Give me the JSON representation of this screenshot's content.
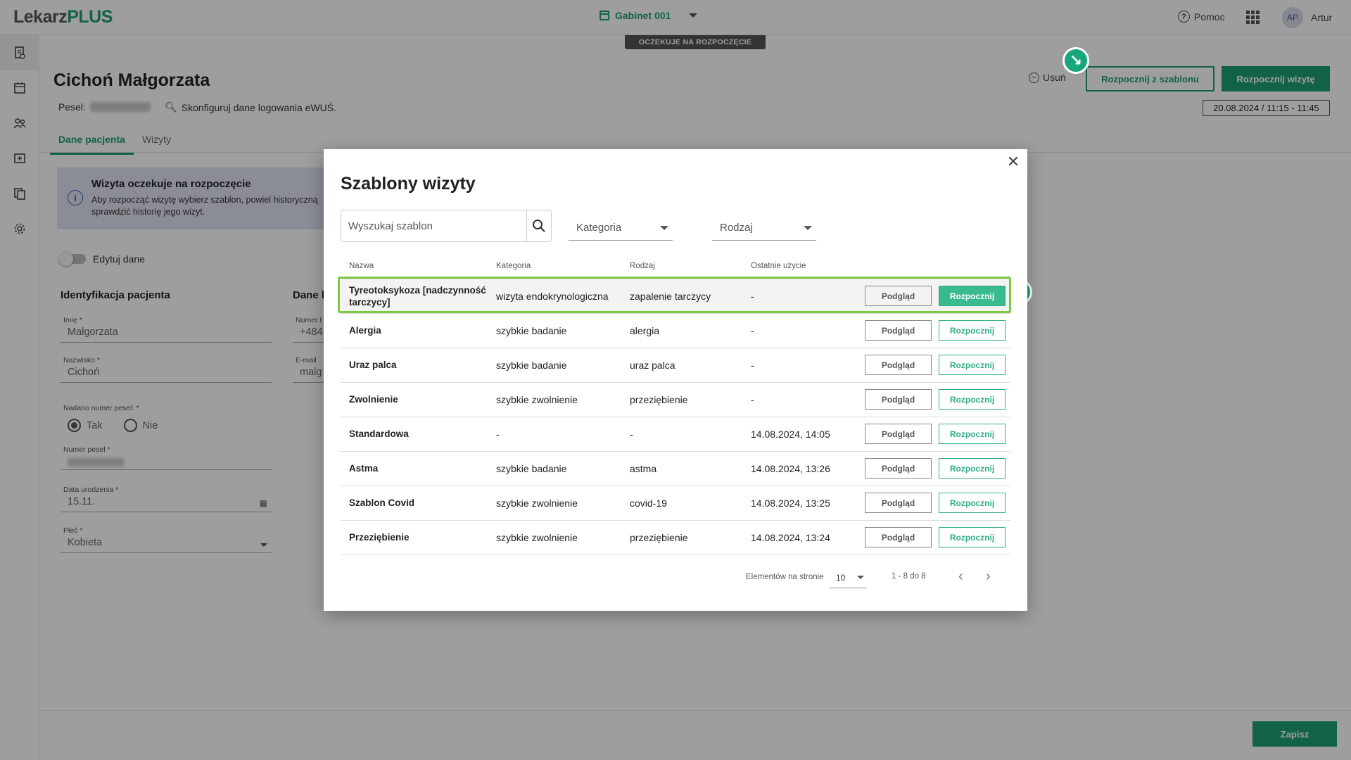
{
  "app": {
    "logo_main": "Lekarz",
    "logo_accent": "PLUS"
  },
  "topbar": {
    "office": "Gabinet 001",
    "help": "Pomoc",
    "avatar_initials": "AP",
    "username": "Artur"
  },
  "sidebar": {
    "items": [
      "document-icon",
      "calendar-icon",
      "patients-icon",
      "add-visit-icon",
      "copy-icon",
      "settings-icon"
    ],
    "expand_icon": "→"
  },
  "visit": {
    "status": "OCZEKUJE NA ROZPOCZĘCIE",
    "patient_name": "Cichoń Małgorzata",
    "pesel_label": "Pesel:",
    "ewus_text": "Skonfiguruj dane logowania eWUŚ.",
    "delete_label": "Usuń",
    "start_from_template_label": "Rozpocznij z szablonu",
    "start_visit_label": "Rozpocznij wizytę",
    "date": "20.08.2024 / 11:15 - 11:45"
  },
  "tabs": [
    "Dane pacjenta",
    "Wizyty"
  ],
  "info": {
    "title": "Wizyta oczekuje na rozpoczęcie",
    "line1": "Aby rozpocząć wizytę wybierz szablon, powiel historyczną",
    "line2": "sprawdzić historię jego wizyt."
  },
  "form": {
    "edit_toggle": "Edytuj dane",
    "section_id": "Identyfikacja pacjenta",
    "section_data": "Dane k",
    "first_name_label": "Imię *",
    "first_name": "Małgorzata",
    "last_name_label": "Nazwisko *",
    "last_name": "Cichoń",
    "pesel_assigned_label": "Nadano numer pesel: *",
    "yes": "Tak",
    "no": "Nie",
    "pesel_number_label": "Numer pesel *",
    "birth_label": "Data urodzenia *",
    "birth": "15.11.",
    "sex_label": "Płeć *",
    "sex": "Kobieta",
    "phone_label": "Numer t",
    "phone": "+484",
    "email_label": "E-mail",
    "email": "malg"
  },
  "footer": {
    "save_label": "Zapisz"
  },
  "modal": {
    "title": "Szablony wizyty",
    "search_placeholder": "Wyszukaj szablon",
    "category_select": "Kategoria",
    "kind_select": "Rodzaj",
    "columns": [
      "Nazwa",
      "Kategoria",
      "Rodzaj",
      "Ostatnie użycie"
    ],
    "preview_label": "Podgląd",
    "start_label": "Rozpocznij",
    "rows": [
      {
        "name": "Tyreotoksykoza [nadczynność tarczycy]",
        "category": "wizyta endokrynologiczna",
        "kind": "zapalenie tarczycy",
        "last": "-"
      },
      {
        "name": "Alergia",
        "category": "szybkie badanie",
        "kind": "alergia",
        "last": "-"
      },
      {
        "name": "Uraz palca",
        "category": "szybkie badanie",
        "kind": "uraz palca",
        "last": "-"
      },
      {
        "name": "Zwolnienie",
        "category": "szybkie zwolnienie",
        "kind": "przeziębienie",
        "last": "-"
      },
      {
        "name": "Standardowa",
        "category": "-",
        "kind": "-",
        "last": "14.08.2024, 14:05"
      },
      {
        "name": "Astma",
        "category": "szybkie badanie",
        "kind": "astma",
        "last": "14.08.2024, 13:26"
      },
      {
        "name": "Szablon Covid",
        "category": "szybkie zwolnienie",
        "kind": "covid-19",
        "last": "14.08.2024, 13:25"
      },
      {
        "name": "Przeziębienie",
        "category": "szybkie zwolnienie",
        "kind": "przeziębienie",
        "last": "14.08.2024, 13:24"
      }
    ],
    "pager": {
      "per_page_label": "Elementów na stronie",
      "per_page": "10",
      "range": "1 - 8 do 8"
    }
  },
  "colors": {
    "accent": "#1e9e74",
    "highlight": "#7bc843",
    "marker": "#18a67c"
  }
}
